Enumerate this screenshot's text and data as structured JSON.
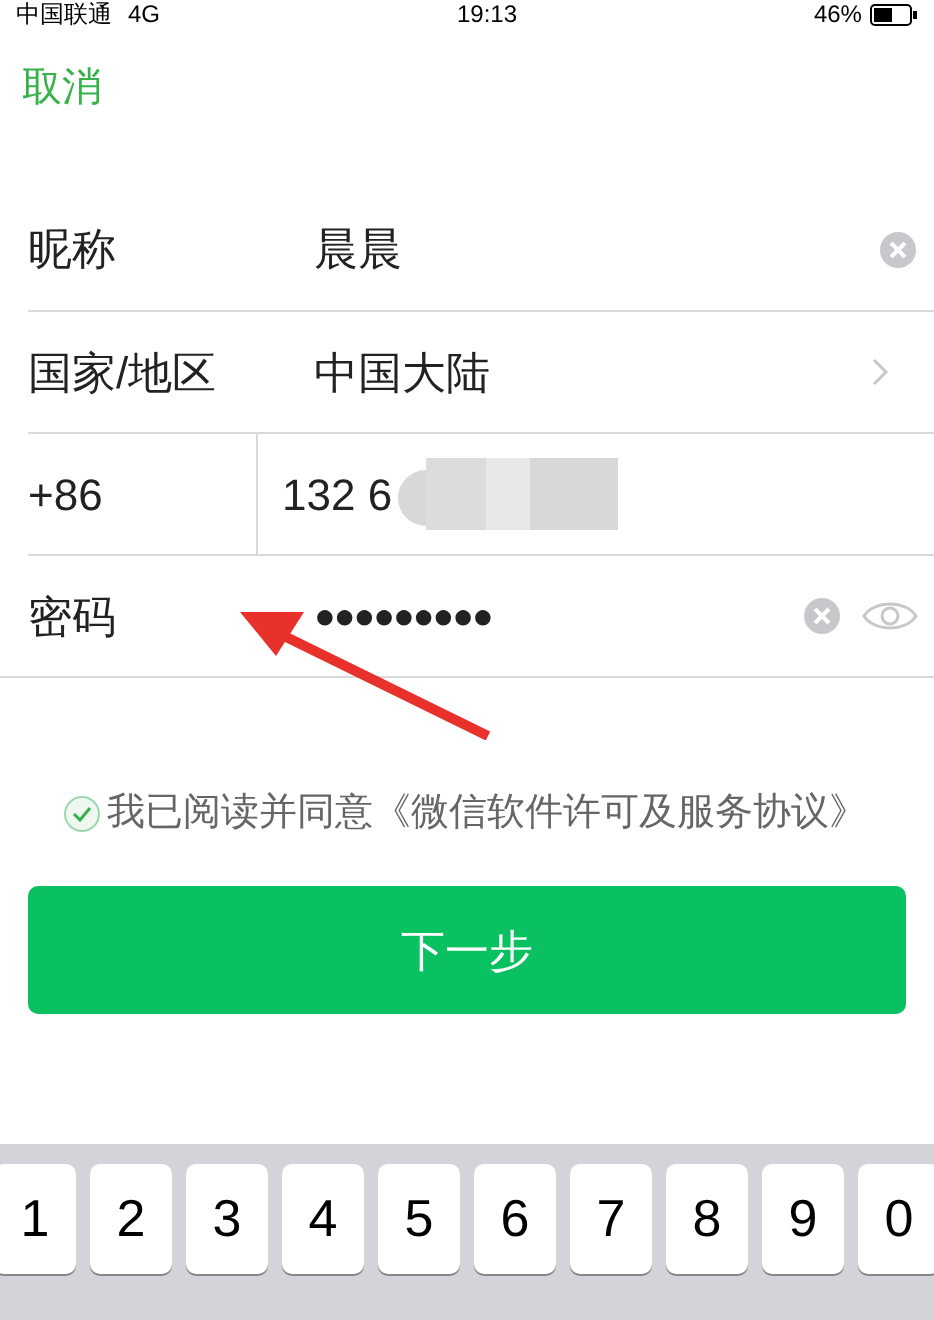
{
  "status_bar": {
    "carrier": "中国联通",
    "network": "4G",
    "time": "19:13",
    "battery": "46%"
  },
  "nav": {
    "cancel": "取消"
  },
  "form": {
    "rows": [
      {
        "kind": "clear",
        "label": "昵称",
        "value": "晨晨"
      },
      {
        "kind": "chevron",
        "label": "国家/地区",
        "value": "中国大陆"
      },
      {
        "kind": "phone",
        "label": "+86",
        "value": "132 6"
      },
      {
        "kind": "password",
        "label": "密码",
        "value": "●●●●●●●●●"
      }
    ]
  },
  "agreement": {
    "checked": true,
    "text": "我已阅读并同意《微信软件许可及服务协议》"
  },
  "next_button": "下一步",
  "keyboard": {
    "keys": [
      "1",
      "2",
      "3",
      "4",
      "5",
      "6",
      "7",
      "8",
      "9",
      "0"
    ]
  }
}
